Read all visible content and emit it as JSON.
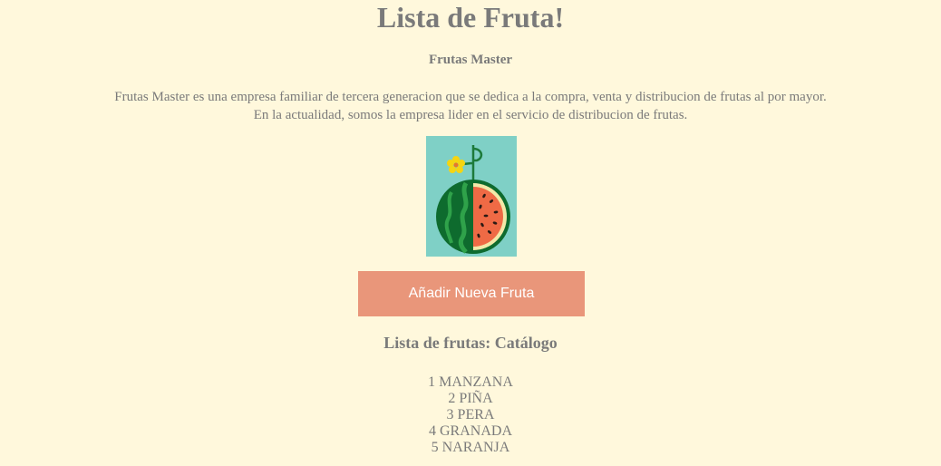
{
  "header": {
    "title": "Lista de Fruta!",
    "company_name": "Frutas Master"
  },
  "description": {
    "line1": "Frutas Master es una empresa familiar de tercera generacion que se dedica a la compra, venta y distribucion de frutas al por mayor.",
    "line2": "En la actualidad, somos la empresa lider en el servicio de distribucion de frutas."
  },
  "logo": {
    "icon": "watermelon-icon",
    "background_color": "#7fd0c6"
  },
  "actions": {
    "add_fruit_label": "Añadir Nueva Fruta",
    "button_color": "#e9967a"
  },
  "catalog": {
    "title": "Lista de frutas: Catálogo",
    "items": [
      "1 MANZANA",
      "2 PIÑA",
      "3 PERA",
      "4 GRANADA",
      "5 NARANJA"
    ]
  },
  "colors": {
    "background": "#fff8dc",
    "text": "#7a7a7a"
  }
}
